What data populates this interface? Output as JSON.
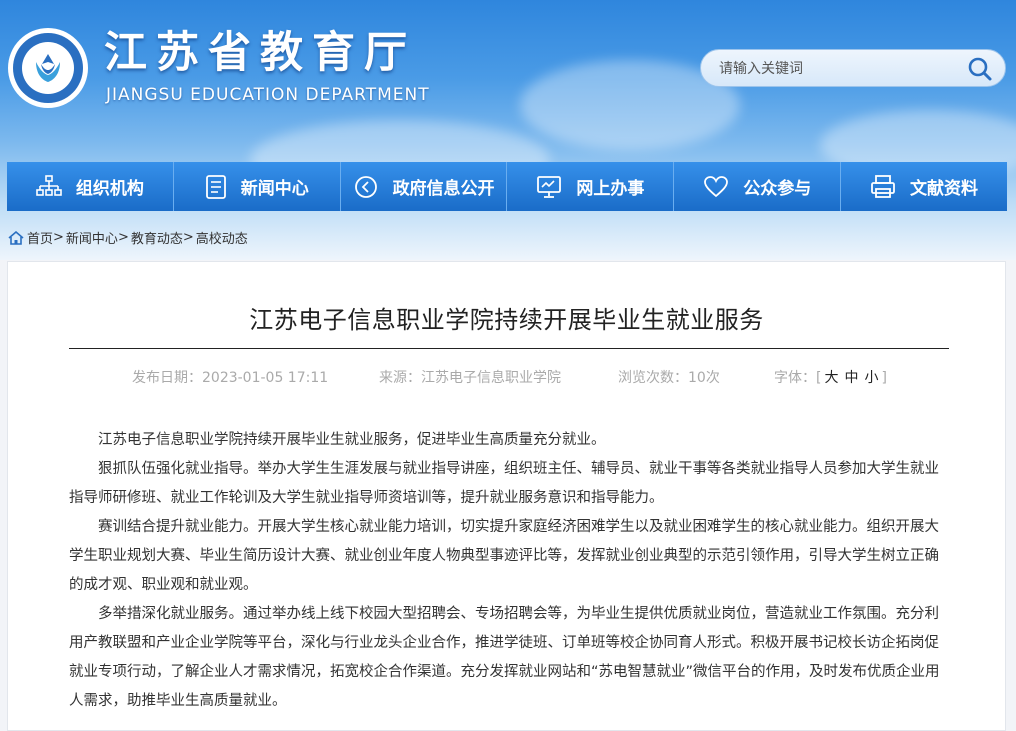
{
  "header": {
    "title": "江苏省教育厅",
    "subtitle": "JIANGSU EDUCATION DEPARTMENT",
    "search": {
      "placeholder": "请输入关键词"
    }
  },
  "nav": {
    "items": [
      {
        "label": "组织机构",
        "icon": "org-chart-icon"
      },
      {
        "label": "新闻中心",
        "icon": "document-icon"
      },
      {
        "label": "政府信息公开",
        "icon": "circle-arrow-icon"
      },
      {
        "label": "网上办事",
        "icon": "monitor-icon"
      },
      {
        "label": "公众参与",
        "icon": "heart-icon"
      },
      {
        "label": "文献资料",
        "icon": "printer-icon"
      }
    ]
  },
  "breadcrumb": {
    "items": [
      "首页",
      "新闻中心",
      "教育动态",
      "高校动态"
    ],
    "separator": ">"
  },
  "article": {
    "title": "江苏电子信息职业学院持续开展毕业生就业服务",
    "meta": {
      "date_label": "发布日期：",
      "date": "2023-01-05 17:11",
      "source_label": "来源：",
      "source": "江苏电子信息职业学院",
      "views_label": "浏览次数：",
      "views": "10次",
      "font_label": "字体：",
      "font_open": "[",
      "font_large": "大",
      "font_medium": "中",
      "font_small": "小",
      "font_close": "]"
    },
    "paragraphs": [
      "江苏电子信息职业学院持续开展毕业生就业服务，促进毕业生高质量充分就业。",
      "狠抓队伍强化就业指导。举办大学生生涯发展与就业指导讲座，组织班主任、辅导员、就业干事等各类就业指导人员参加大学生就业指导师研修班、就业工作轮训及大学生就业指导师资培训等，提升就业服务意识和指导能力。",
      "赛训结合提升就业能力。开展大学生核心就业能力培训，切实提升家庭经济困难学生以及就业困难学生的核心就业能力。组织开展大学生职业规划大赛、毕业生简历设计大赛、就业创业年度人物典型事迹评比等，发挥就业创业典型的示范引领作用，引导大学生树立正确的成才观、职业观和就业观。",
      "多举措深化就业服务。通过举办线上线下校园大型招聘会、专场招聘会等，为毕业生提供优质就业岗位，营造就业工作氛围。充分利用产教联盟和产业企业学院等平台，深化与行业龙头企业合作，推进学徒班、订单班等校企协同育人形式。积极开展书记校长访企拓岗促就业专项行动，了解企业人才需求情况，拓宽校企合作渠道。充分发挥就业网站和“苏电智慧就业”微信平台的作用，及时发布优质企业用人需求，助推毕业生高质量就业。"
    ]
  },
  "colors": {
    "nav_bg": "#1a6cc8",
    "header_top": "#2f86dd",
    "text": "#333333",
    "meta_text": "#aaaaaa"
  }
}
